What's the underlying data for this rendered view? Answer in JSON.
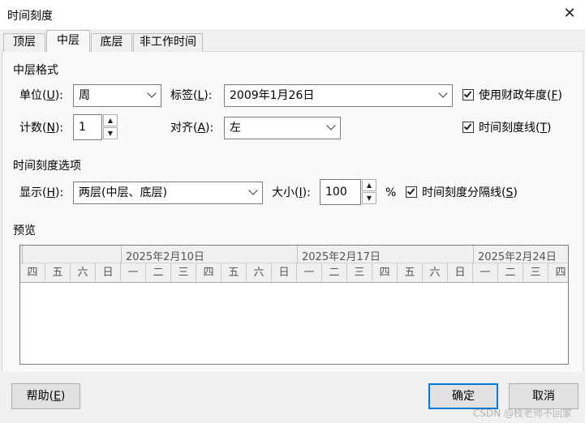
{
  "window": {
    "title": "时间刻度",
    "close_glyph": "✕"
  },
  "tabs": [
    {
      "label": "顶层",
      "active": false
    },
    {
      "label": "中层",
      "active": true
    },
    {
      "label": "底层",
      "active": false
    },
    {
      "label": "非工作时间",
      "active": false
    }
  ],
  "format_section": {
    "heading": "中层格式",
    "unit": {
      "label": "单位(",
      "accel": "U",
      "label_end": "):",
      "value": "周"
    },
    "tag": {
      "label": "标签(",
      "accel": "L",
      "label_end": "):",
      "value": "2009年1月26日"
    },
    "fiscal": {
      "label": "使用财政年度(",
      "accel": "F",
      "label_end": ")",
      "checked": true
    },
    "count": {
      "label": "计数(",
      "accel": "N",
      "label_end": "):",
      "value": "1"
    },
    "align": {
      "label": "对齐(",
      "accel": "A",
      "label_end": "):",
      "value": "左"
    },
    "tick_lines": {
      "label": "时间刻度线(",
      "accel": "T",
      "label_end": ")",
      "checked": true
    }
  },
  "options_section": {
    "heading": "时间刻度选项",
    "show": {
      "label": "显示(",
      "accel": "H",
      "label_end": "):",
      "value": "两层(中层、底层)"
    },
    "size": {
      "label": "大小(",
      "accel": "I",
      "label_end": "):",
      "value": "100",
      "unit": "%"
    },
    "separator": {
      "label": "时间刻度分隔线(",
      "accel": "S",
      "label_end": ")",
      "checked": true
    }
  },
  "preview": {
    "heading": "预览",
    "mid_labels": [
      "2025年2月10日",
      "2025年2月17日",
      "2025年2月24日"
    ],
    "days": [
      "四",
      "五",
      "六",
      "日",
      "一",
      "二",
      "三",
      "四",
      "五",
      "六",
      "日",
      "一",
      "二",
      "三",
      "四",
      "五",
      "六",
      "日",
      "一",
      "二",
      "三",
      "四"
    ]
  },
  "buttons": {
    "help": {
      "label": "帮助(",
      "accel": "E",
      "label_end": ")"
    },
    "ok": "确定",
    "cancel": "取消"
  },
  "watermark": "CSDN @枝老师不回家",
  "colors": {
    "accent": "#0078d7",
    "background": "#f0f0f0",
    "panel": "#f9f9f9"
  }
}
